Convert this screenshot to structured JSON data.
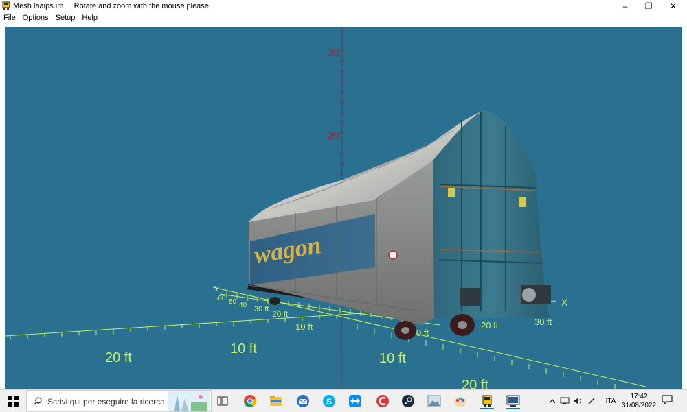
{
  "window": {
    "title": "Mesh laaips.im",
    "hint": "Rotate and zoom with the mouse please.",
    "minimize": "–",
    "restore": "❐",
    "close": "✕"
  },
  "menu": [
    "File",
    "Options",
    "Setup",
    "Help"
  ],
  "scene": {
    "background": "#2a7091",
    "axis_color": "#c8f05a",
    "vertical_axis_color": "#8a2d3a",
    "wagon_text": "wagon",
    "labels": {
      "v30": "30",
      "v20": "20",
      "x_axis": "X",
      "left_20": "20 ft",
      "left_10": "10 ft",
      "front_10": "10 ft",
      "front_20": "20 ft",
      "y_axis": "Y",
      "y_60": "-60",
      "y_50": "50",
      "y_40": "40",
      "y_30": "30 ft",
      "y_20": "20 ft",
      "near_10": "10 ft",
      "x_10": "0 ft",
      "x_30": "30 ft",
      "x_20": "20 ft"
    }
  },
  "taskbar": {
    "search_placeholder": "Scrivi qui per eseguire la ricerca",
    "language": "ITA",
    "time": "17:42",
    "date": "31/08/2022",
    "icons": [
      "task-view-icon",
      "chrome-icon",
      "file-explorer-icon",
      "thunderbird-icon",
      "skype-icon",
      "teamviewer-icon",
      "ccleaner-icon",
      "steam-icon",
      "photos-icon",
      "paint-icon",
      "train-app-icon",
      "settings-app-icon"
    ]
  }
}
